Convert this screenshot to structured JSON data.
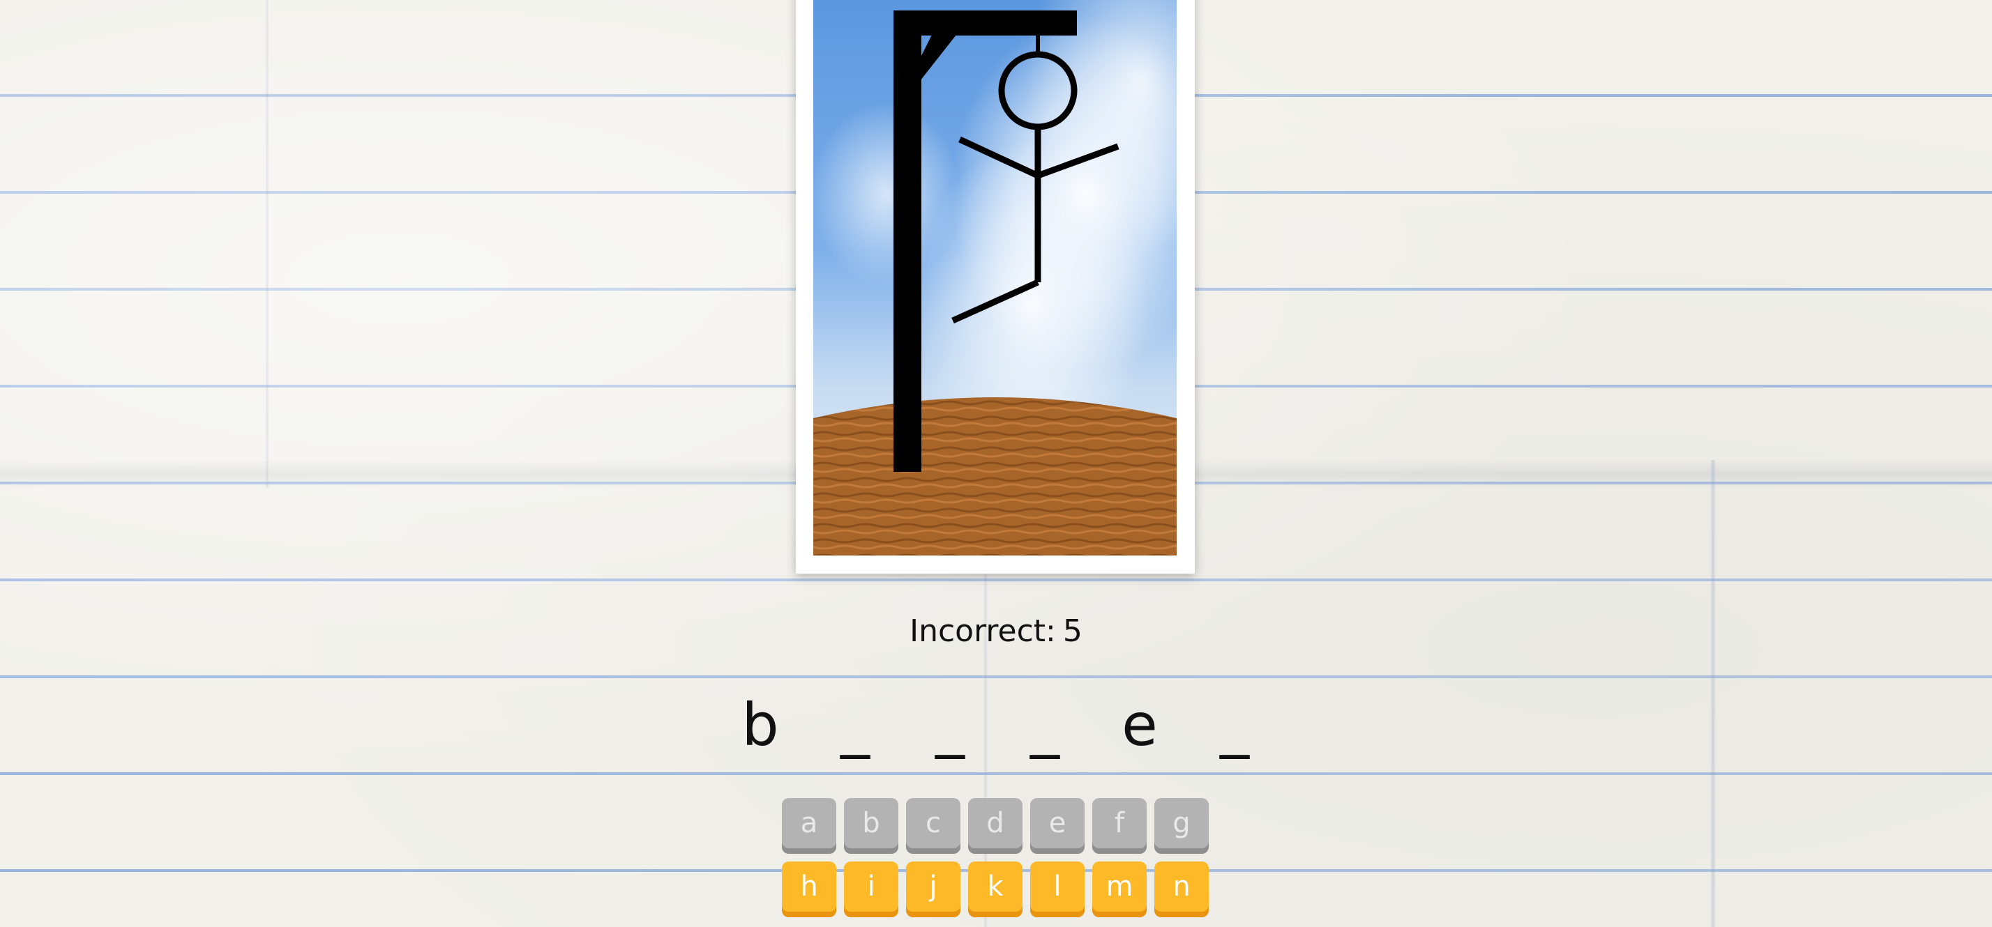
{
  "game": {
    "incorrect_label": "Incorrect:",
    "incorrect_count": "5",
    "word_slots": [
      "b",
      "_",
      "_",
      "_",
      "e",
      "_"
    ],
    "keyboard_rows": [
      [
        {
          "letter": "a",
          "state": "used"
        },
        {
          "letter": "b",
          "state": "used"
        },
        {
          "letter": "c",
          "state": "used"
        },
        {
          "letter": "d",
          "state": "used"
        },
        {
          "letter": "e",
          "state": "used"
        },
        {
          "letter": "f",
          "state": "used"
        },
        {
          "letter": "g",
          "state": "used"
        }
      ],
      [
        {
          "letter": "h",
          "state": "available"
        },
        {
          "letter": "i",
          "state": "available"
        },
        {
          "letter": "j",
          "state": "available"
        },
        {
          "letter": "k",
          "state": "available"
        },
        {
          "letter": "l",
          "state": "available"
        },
        {
          "letter": "m",
          "state": "available"
        },
        {
          "letter": "n",
          "state": "available"
        }
      ]
    ]
  },
  "colors": {
    "key_available": "#fdb928",
    "key_used": "#b3b3b3",
    "paper_line": "#9ab6df"
  },
  "icons": {
    "scene": "hangman-gallows-icon"
  }
}
